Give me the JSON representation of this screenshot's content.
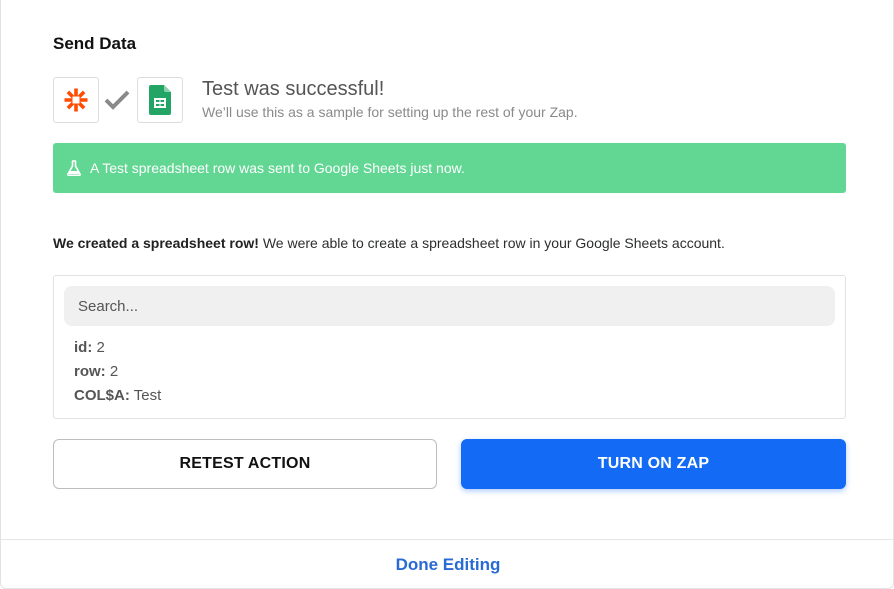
{
  "section": {
    "title": "Send Data"
  },
  "apps": {
    "trigger_icon": "zapier-asterisk-icon",
    "status_icon": "checkmark-icon",
    "action_icon": "google-sheets-icon",
    "colors": {
      "zapier": "#ff4a00",
      "sheets": "#23a566",
      "check": "#8a8a8a"
    }
  },
  "test_result": {
    "title": "Test was successful!",
    "subtitle": "We’ll use this as a sample for setting up the rest of your Zap."
  },
  "alert": {
    "icon": "flask-icon",
    "text": "A Test spreadsheet row was sent to Google Sheets just now.",
    "background": "#62d693"
  },
  "result": {
    "lead": "We created a spreadsheet row!",
    "text": " We were able to create a spreadsheet row in your Google Sheets account."
  },
  "data_box": {
    "search_placeholder": "Search...",
    "fields": [
      {
        "key": "id:",
        "value": " 2"
      },
      {
        "key": "row:",
        "value": " 2"
      },
      {
        "key": "COL$A:",
        "value": " Test"
      }
    ]
  },
  "buttons": {
    "retest_label": "RETEST ACTION",
    "turn_on_label": "TURN ON ZAP",
    "primary_color": "#136bf5"
  },
  "footer": {
    "done_label": "Done Editing"
  }
}
